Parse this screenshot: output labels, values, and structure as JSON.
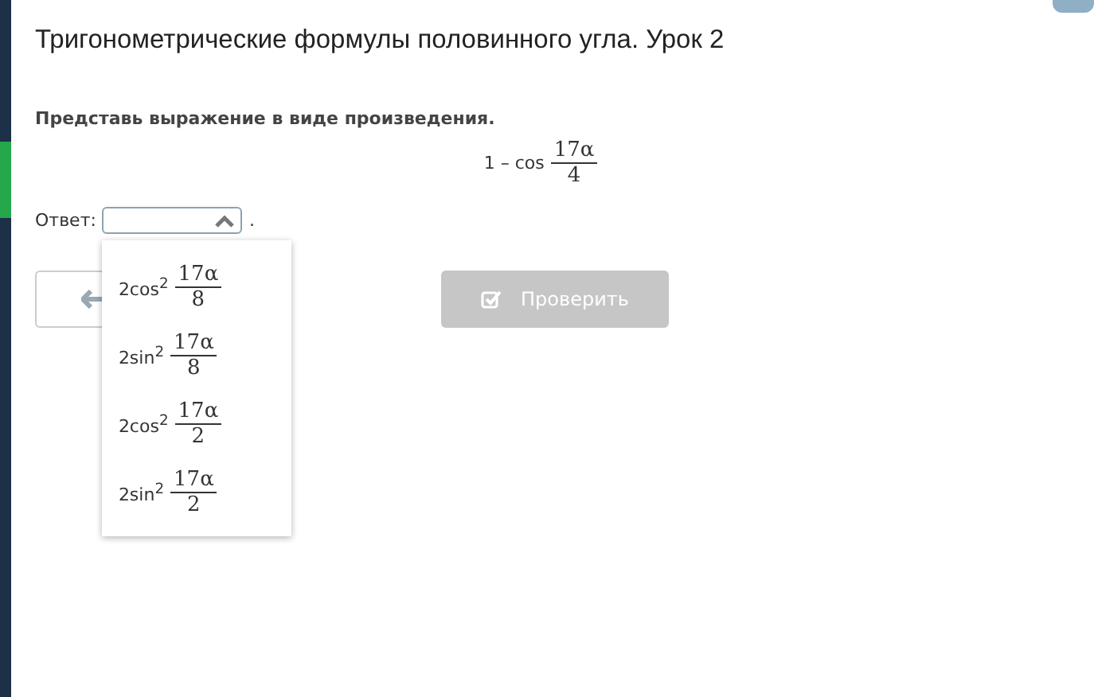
{
  "title": "Тригонометрические формулы половинного угла. Урок 2",
  "instruction": "Представь выражение в виде произведения.",
  "expression": {
    "prefix": "1 – cos",
    "numerator": "17α",
    "denominator": "4"
  },
  "answer": {
    "label": "Ответ:",
    "suffix": ".",
    "expanded": true,
    "options": [
      {
        "prefix": "2cos$^{2}$",
        "numerator": "17α",
        "denominator": "8",
        "selected": false
      },
      {
        "prefix": "2sin$^{2}$",
        "numerator": "17α",
        "denominator": "8",
        "selected": false
      },
      {
        "prefix": "2cos$^{2}$",
        "numerator": "17α",
        "denominator": "2",
        "selected": false
      },
      {
        "prefix": "2sin$^{2}$",
        "numerator": "17α",
        "denominator": "2",
        "selected": false
      }
    ]
  },
  "check_button": {
    "label": "Проверить",
    "disabled": true
  }
}
